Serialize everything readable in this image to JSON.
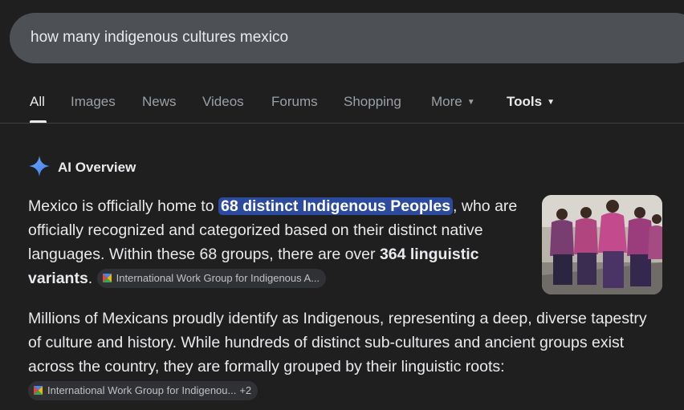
{
  "search": {
    "query": "how many indigenous cultures mexico"
  },
  "tabs": [
    {
      "label": "All"
    },
    {
      "label": "Images"
    },
    {
      "label": "News"
    },
    {
      "label": "Videos"
    },
    {
      "label": "Forums"
    },
    {
      "label": "Shopping"
    },
    {
      "label": "More"
    },
    {
      "label": "Tools"
    }
  ],
  "ai_overview": {
    "title": "AI Overview",
    "icon": "sparkle-icon",
    "p1": {
      "pre": "Mexico is officially home to ",
      "highlight": "68 distinct Indigenous Peoples",
      "mid": ", who are officially recognized and categorized based on their distinct native languages. Within these 68 groups, there are over ",
      "bold": "364 linguistic variants",
      "post": "."
    },
    "p1_source": "International Work Group for Indigenous A...",
    "p2": {
      "text": "Millions of Mexicans proudly identify as Indigenous, representing a deep, diverse tapestry of culture and history. While hundreds of distinct sub-cultures and ancient groups exist across the country, they are formally grouped by their linguistic roots:"
    },
    "p2_source": "International Work Group for Indigenou...",
    "p2_source_extra": "+2",
    "image_alt": "photo-thumbnail"
  },
  "colors": {
    "background": "#1f1f1f",
    "searchbar": "#4d5156",
    "highlight": "#2d4b9e",
    "sparkle": "#4f8ef7"
  }
}
